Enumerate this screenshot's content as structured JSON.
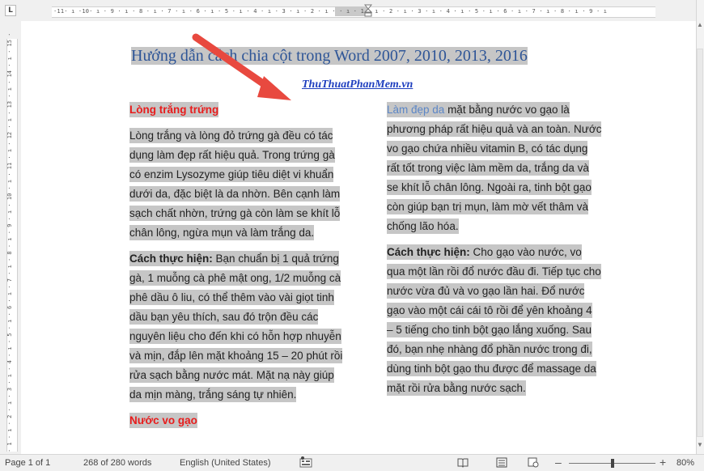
{
  "ruler": {
    "horizontal_ticks": "·11· ı ·10· ı · 9 · ı · 8 · ı · 7 · ı · 6 · ı · 5 · ı · 4 · ı · 3 · ı · 2 · ı ·            · ı · 1 · ı · 2 · ı · 3 · ı · 4 · ı · 5 · ı · 6 · ı · 7 · ı · 8 · ı · 9 · ı",
    "vertical_ticks": "· 1 · ı · 2 · ı · 3 · ı · 4 · ı · 5 · ı · 6 · ı · 7 · ı · 8 · ı · 9 · ı · 10 · ı · 11 · ı · 12 · ı · 13 · ı · 14 · ı · 15 ·",
    "corner_symbol": "L"
  },
  "document": {
    "title": "Hướng dẫn cách chia cột trong Word 2007, 2010, 2013, 2016",
    "site_link": "ThuThuatPhanMem.vn",
    "left_column": {
      "heading1": "Lòng trắng trứng",
      "para1_lines": [
        "Lòng trắng và lòng đỏ trứng gà đều có tác",
        "dụng làm đẹp rất hiệu quả. Trong trứng gà",
        "có enzim Lysozyme giúp tiêu diệt vi khuẩn",
        "dưới da, đặc biệt là da nhờn. Bên cạnh làm",
        "sạch chất nhờn, trứng gà còn làm se khít lỗ",
        "chân lông, ngừa mụn và làm trắng da."
      ],
      "para2_label": "Cách thực hiện:",
      "para2_first_rest": " Bạn chuẩn bị 1 quả trứng",
      "para2_lines": [
        "gà, 1 muỗng cà phê mật ong, 1/2 muỗng cà",
        "phê dầu ô liu, có thể thêm vào vài giọt tinh",
        "dầu bạn yêu thích, sau đó trộn đều các",
        "nguyên liệu cho đến khi có hỗn hợp nhuyễn",
        "và mịn, đắp lên mặt khoảng 15 – 20 phút rồi",
        "rửa sạch bằng nước mát. Mặt nạ này giúp",
        "da mịn màng, trắng sáng tự nhiên."
      ],
      "heading2": "Nước vo gạo"
    },
    "right_column": {
      "para1_lead": "Làm đẹp da",
      "para1_first_rest": " mặt bằng nước vo gạo là",
      "para1_lines": [
        "phương pháp rất hiệu quả và an toàn. Nước",
        "vo gạo chứa nhiều vitamin B, có tác dụng",
        "rất tốt trong việc làm mềm da, trắng da và",
        "se khít lỗ chân lông. Ngoài ra, tinh bột gạo",
        "còn giúp bạn trị mụn, làm mờ vết thâm và",
        "chống lão hóa."
      ],
      "para2_label": "Cách thực hiện:",
      "para2_first_rest": " Cho gạo vào nước, vo",
      "para2_lines": [
        "qua một lần rồi đổ nước đầu đi. Tiếp tục cho",
        "nước vừa đủ và vo gạo lần hai. Đổ nước",
        "gạo vào một cái cái tô rồi để yên khoảng 4",
        "– 5 tiếng cho tinh bột gạo lắng xuống. Sau",
        "đó, bạn nhẹ nhàng đổ phần nước trong đi,",
        "dùng tinh bột gạo thu được để massage da",
        "mặt rồi rửa bằng nước sạch."
      ]
    }
  },
  "status": {
    "page": "Page 1 of 1",
    "words": "268 of 280 words",
    "language": "English (United States)",
    "zoom_minus": "–",
    "zoom_plus": "+",
    "zoom": "80%",
    "zoom_level_fraction": 0.5
  },
  "colors": {
    "title": "#2e5597",
    "heading": "#e81c1c",
    "link": "#1f3fbf",
    "selection": "#c6c6c6",
    "arrow": "#e8493f"
  }
}
